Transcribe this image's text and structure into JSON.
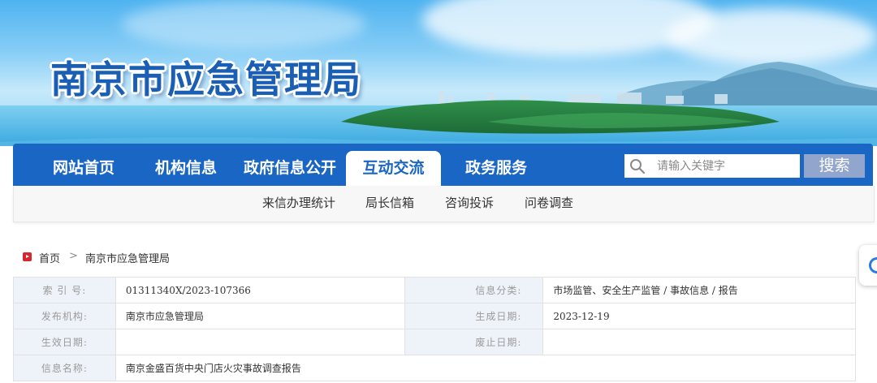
{
  "site": {
    "title": "南京市应急管理局"
  },
  "nav": {
    "items": [
      "网站首页",
      "机构信息",
      "政府信息公开",
      "互动交流",
      "政务服务"
    ],
    "active": "互动交流"
  },
  "search": {
    "placeholder": "请输入关键字",
    "button_label": "搜索"
  },
  "subnav": {
    "items": [
      "来信办理统计",
      "局长信箱",
      "咨询投诉",
      "问卷调查"
    ]
  },
  "breadcrumb": {
    "home": "首页",
    "separator": ">",
    "current": "南京市应急管理局"
  },
  "info_table": {
    "index_label": "索 引 号:",
    "index_value": "01311340X/2023-107366",
    "category_label": "信息分类:",
    "category_value": "市场监管、安全生产监管 / 事故信息 / 报告",
    "publisher_label": "发布机构:",
    "publisher_value": "南京市应急管理局",
    "created_label": "生成日期:",
    "created_value": "2023-12-19",
    "effective_label": "生效日期:",
    "effective_value": "",
    "expire_label": "废止日期:",
    "expire_value": "",
    "name_label": "信息名称:",
    "name_value": "南京金盛百货中央门店火灾事故调查报告"
  },
  "colors": {
    "nav_blue": "#1a66c4",
    "search_button": "#92a5cd",
    "label_bg": "#eef3fa",
    "home_icon_red": "#d9262c"
  },
  "icons": {
    "search": "search-icon",
    "home": "home-play-icon",
    "float": "refresh-icon"
  }
}
